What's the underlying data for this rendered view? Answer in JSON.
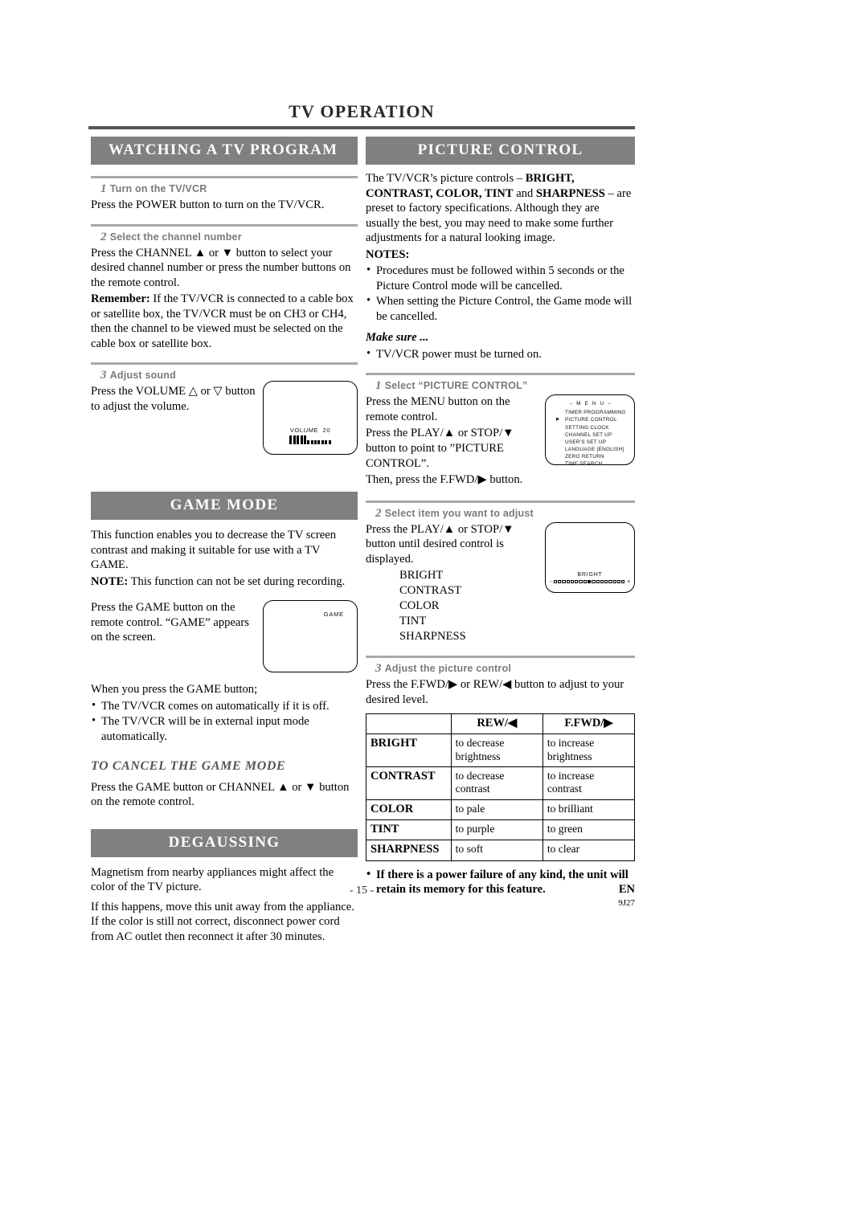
{
  "page": {
    "title": "TV OPERATION",
    "page_number": "- 15 -",
    "footer_lang": "EN",
    "footer_code": "9J27"
  },
  "watching": {
    "heading": "WATCHING A TV PROGRAM",
    "step1": {
      "num": "1",
      "label": "Turn on the TV/VCR",
      "body": "Press the POWER button to turn on the TV/VCR."
    },
    "step2": {
      "num": "2",
      "label": "Select the channel number",
      "body1": "Press the CHANNEL ▲ or ▼ button to select your desired channel number or press the number buttons on the remote control.",
      "remember_label": "Remember:",
      "remember_body": " If the TV/VCR is connected to a cable box or satellite box, the TV/VCR must be on CH3 or CH4, then the channel to be viewed must be selected on the cable box or satellite box."
    },
    "step3": {
      "num": "3",
      "label": "Adjust sound",
      "body": "Press the VOLUME △ or ▽ button to adjust the volume."
    },
    "volume_osd": {
      "label": "VOLUME",
      "value": "20",
      "filled_bars": 5,
      "empty_bars": 7
    }
  },
  "game_mode": {
    "heading": "GAME MODE",
    "intro": "This function enables you to decrease the TV screen contrast and making it suitable for use with a TV GAME.",
    "note_label": "NOTE:",
    "note_body": " This function can not be set during recording.",
    "press_body": "Press the GAME button on the remote control. “GAME” appears on the screen.",
    "when_body": "When you press the GAME button;",
    "bullets": [
      "The TV/VCR comes on automatically if it is off.",
      "The TV/VCR will be in external input mode automatically."
    ],
    "cancel_heading": "TO CANCEL THE GAME MODE",
    "cancel_body": "Press the GAME button or CHANNEL ▲ or ▼ button on the remote control.",
    "game_osd": "GAME"
  },
  "degaussing": {
    "heading": "DEGAUSSING",
    "para1": "Magnetism from nearby appliances might affect the color of the TV picture.",
    "para2": "If this happens, move this unit away from the appliance. If the color is still not correct, disconnect power cord from AC outlet then reconnect it after 30 minutes."
  },
  "picture_control": {
    "heading": "PICTURE CONTROL",
    "intro_pre": "The TV/VCR’s picture controls – ",
    "intro_bold": "BRIGHT, CONTRAST, COLOR, TINT",
    "intro_mid": " and ",
    "intro_bold2": "SHARPNESS",
    "intro_post": " – are preset to factory specifications. Although they are usually the best, you may need to make some further adjustments for a natural looking image.",
    "notes_label": "NOTES:",
    "notes": [
      "Procedures must be followed within 5 seconds or the Picture Control mode will be cancelled.",
      "When setting the Picture Control, the Game mode will be cancelled."
    ],
    "make_sure_label": "Make sure ...",
    "make_sure_items": [
      "TV/VCR power must be turned on."
    ],
    "step1": {
      "num": "1",
      "label": "Select “PICTURE CONTROL”",
      "body1": "Press the MENU button on the remote control.",
      "body2": "Press the PLAY/▲ or STOP/▼ button to point to ”PICTURE CONTROL”.",
      "body3": "Then, press the F.FWD/▶ button."
    },
    "step2": {
      "num": "2",
      "label": "Select item you want to adjust",
      "body": "Press the PLAY/▲ or STOP/▼ button until desired control is displayed.",
      "items": [
        "BRIGHT",
        "CONTRAST",
        "COLOR",
        "TINT",
        "SHARPNESS"
      ]
    },
    "step3": {
      "num": "3",
      "label": "Adjust the picture control",
      "body": "Press the F.FWD/▶ or REW/◀ button to adjust to your desired level."
    },
    "menu_osd": {
      "title": "– M E N U –",
      "items": [
        "TIMER PROGRAMMING",
        "PICTURE CONTROL",
        "SETTING CLOCK",
        "CHANNEL SET UP",
        "USER'S SET UP",
        "LANGUAGE  [ENGLISH]",
        "ZERO RETURN",
        "TIME SEARCH"
      ],
      "selected_index": 1
    },
    "bright_osd": {
      "label": "BRIGHT",
      "minus": "-",
      "plus": "+",
      "total_boxes": 17,
      "filled_index": 8
    },
    "table": {
      "headers": [
        "",
        "REW/◀",
        "F.FWD/▶"
      ],
      "rows": [
        {
          "name": "BRIGHT",
          "rew": "to decrease brightness",
          "ffwd": "to increase brightness"
        },
        {
          "name": "CONTRAST",
          "rew": "to decrease contrast",
          "ffwd": "to increase contrast"
        },
        {
          "name": "COLOR",
          "rew": "to pale",
          "ffwd": "to brilliant"
        },
        {
          "name": "TINT",
          "rew": "to purple",
          "ffwd": "to green"
        },
        {
          "name": "SHARPNESS",
          "rew": "to soft",
          "ffwd": "to clear"
        }
      ]
    },
    "final_note": "If there is a power failure of any kind, the unit will retain its memory for this feature."
  },
  "colors": {
    "section_bar": "#808080",
    "rule": "#555555",
    "step_rule": "#a9a9a9",
    "step_text": "#7a7a7a"
  }
}
